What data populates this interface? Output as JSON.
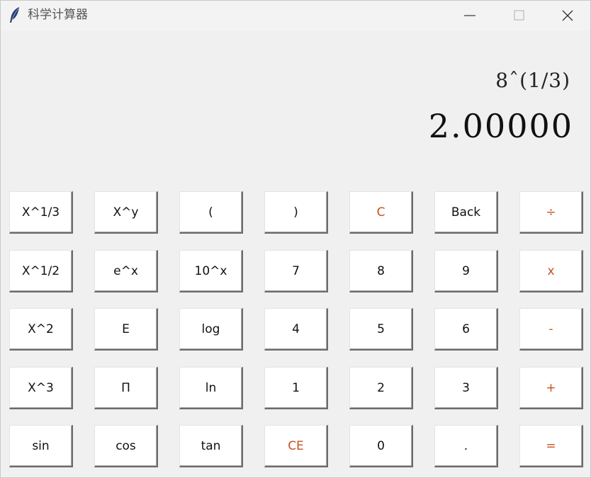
{
  "window": {
    "title": "科学计算器",
    "app_icon": "feather-icon",
    "controls": [
      "minimize-icon",
      "maximize-icon",
      "close-icon"
    ]
  },
  "display": {
    "expression": "8ˆ(1/3)",
    "result": "2.00000"
  },
  "colors": {
    "accent": "#c8501e",
    "button_bg": "#ffffff",
    "window_bg": "#f0f0f0"
  },
  "keypad": {
    "rows": [
      [
        {
          "label": "X^1/3",
          "name": "cube-root"
        },
        {
          "label": "X^y",
          "name": "power"
        },
        {
          "label": "(",
          "name": "open-paren"
        },
        {
          "label": ")",
          "name": "close-paren"
        },
        {
          "label": "C",
          "name": "clear",
          "accent": true
        },
        {
          "label": "Back",
          "name": "backspace"
        },
        {
          "label": "÷",
          "name": "divide",
          "accent": true
        }
      ],
      [
        {
          "label": "X^1/2",
          "name": "square-root"
        },
        {
          "label": "e^x",
          "name": "exp"
        },
        {
          "label": "10^x",
          "name": "ten-power"
        },
        {
          "label": "7",
          "name": "digit-7"
        },
        {
          "label": "8",
          "name": "digit-8"
        },
        {
          "label": "9",
          "name": "digit-9"
        },
        {
          "label": "x",
          "name": "multiply",
          "accent": true
        }
      ],
      [
        {
          "label": "X^2",
          "name": "square"
        },
        {
          "label": "E",
          "name": "euler"
        },
        {
          "label": "log",
          "name": "log"
        },
        {
          "label": "4",
          "name": "digit-4"
        },
        {
          "label": "5",
          "name": "digit-5"
        },
        {
          "label": "6",
          "name": "digit-6"
        },
        {
          "label": "-",
          "name": "subtract",
          "accent": true
        }
      ],
      [
        {
          "label": "X^3",
          "name": "cube"
        },
        {
          "label": "Π",
          "name": "pi"
        },
        {
          "label": "ln",
          "name": "ln"
        },
        {
          "label": "1",
          "name": "digit-1"
        },
        {
          "label": "2",
          "name": "digit-2"
        },
        {
          "label": "3",
          "name": "digit-3"
        },
        {
          "label": "+",
          "name": "add",
          "accent": true
        }
      ],
      [
        {
          "label": "sin",
          "name": "sin"
        },
        {
          "label": "cos",
          "name": "cos"
        },
        {
          "label": "tan",
          "name": "tan"
        },
        {
          "label": "CE",
          "name": "clear-entry",
          "accent": true
        },
        {
          "label": "0",
          "name": "digit-0"
        },
        {
          "label": ".",
          "name": "decimal-point"
        },
        {
          "label": "=",
          "name": "equals",
          "accent": true
        }
      ]
    ]
  }
}
